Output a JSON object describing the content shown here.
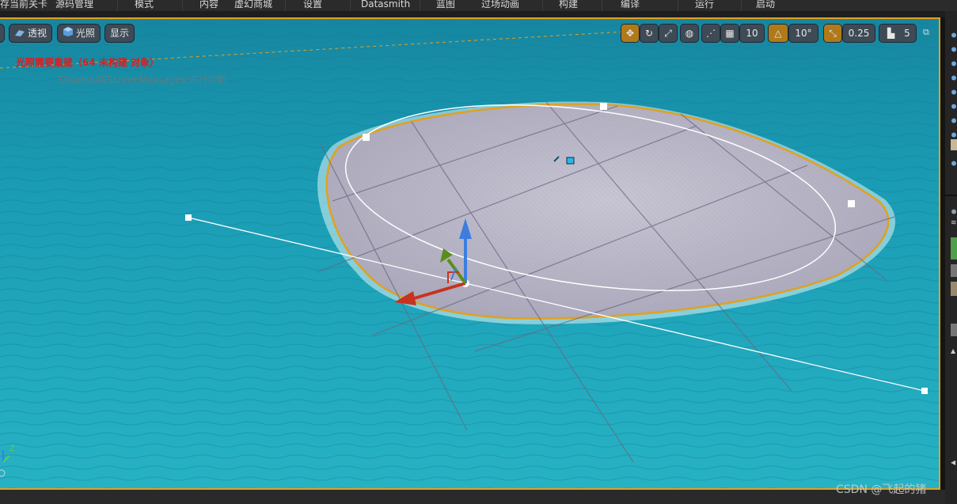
{
  "menu": {
    "items": [
      {
        "label": "存当前关卡"
      },
      {
        "label": "源码管理"
      },
      {
        "label": "模式"
      },
      {
        "label": "内容"
      },
      {
        "label": "虚幻商城"
      },
      {
        "label": "设置"
      },
      {
        "label": "Datasmith"
      },
      {
        "label": "蓝图"
      },
      {
        "label": "过场动画"
      },
      {
        "label": "构建"
      },
      {
        "label": "编译"
      },
      {
        "label": "运行"
      },
      {
        "label": "启动"
      }
    ]
  },
  "viewport": {
    "perspective_label": "透视",
    "lighting_label": "光照",
    "show_label": "显示",
    "grid_snap_value": "10",
    "rotation_snap_value": "10°",
    "scale_snap_value": "0.25",
    "camera_speed_value": "5",
    "lighting_warning": "光照需要重建（64 未构建 对象）",
    "message_note": "'DisableAllScreenMessages'进行抑制",
    "axis_z_label": "Z"
  },
  "watermark": "CSDN @飞起的猪",
  "colors": {
    "selection_outline": "#e3a11d",
    "water": "#1a9fb5",
    "warning_text": "#e01c1c",
    "gizmo_x": "#c8331f",
    "gizmo_y": "#5c8c1c",
    "gizmo_z": "#3b7ee0"
  },
  "icons": [
    "transform-move-icon",
    "rotate-icon",
    "scale-icon",
    "world-icon",
    "surface-snap-icon",
    "grid-icon",
    "angle-icon",
    "scale-snap-icon",
    "camera-speed-icon",
    "maximize-icon"
  ]
}
